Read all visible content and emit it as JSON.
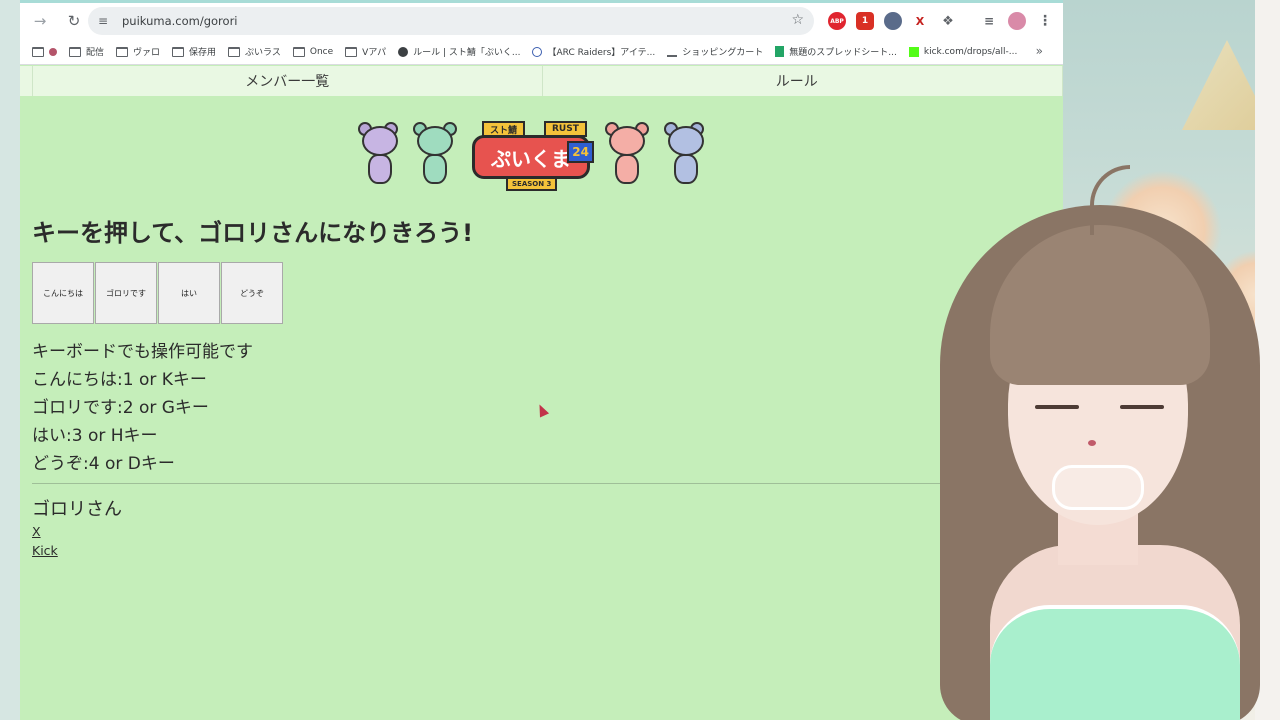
{
  "browser": {
    "url": "puikuma.com/gorori",
    "bookmarks": [
      "",
      "配信",
      "ヴァロ",
      "保存用",
      "ぷいラス",
      "Once",
      "Vアパ",
      "ルール | スト鯖「ぷいく...",
      "【ARC Raiders】アイテ...",
      "ショッピングカート",
      "無題のスプレッドシート...",
      "kick.com/drops/all-..."
    ],
    "extensions": [
      {
        "name": "adblock",
        "label": "ABP",
        "color": "#e0252f"
      },
      {
        "name": "ext-red",
        "label": "1",
        "color": "#d93025"
      },
      {
        "name": "ext-globe",
        "label": "",
        "color": "#5a6b8a"
      },
      {
        "name": "ext-x",
        "label": "X",
        "color": "#c5221f"
      },
      {
        "name": "puzzle",
        "label": "",
        "color": "#5f6368"
      }
    ]
  },
  "nav": {
    "members": "メンバー一覧",
    "rules": "ルール"
  },
  "logo": {
    "title": "ぷいくま",
    "tag_left": "スト鯖",
    "tag_right": "RUST",
    "number": "24",
    "season": "SEASON 3"
  },
  "page": {
    "heading": "キーを押して、ゴロリさんになりきろう!",
    "buttons": [
      "こんにちは",
      "ゴロリです",
      "はい",
      "どうぞ"
    ],
    "help_lines": [
      "キーボードでも操作可能です",
      "こんにちは:1 or Kキー",
      "ゴロリです:2 or Gキー",
      "はい:3 or Hキー",
      "どうぞ:4 or Dキー"
    ],
    "person": "ゴロリさん",
    "links": [
      "X",
      "Kick"
    ]
  }
}
